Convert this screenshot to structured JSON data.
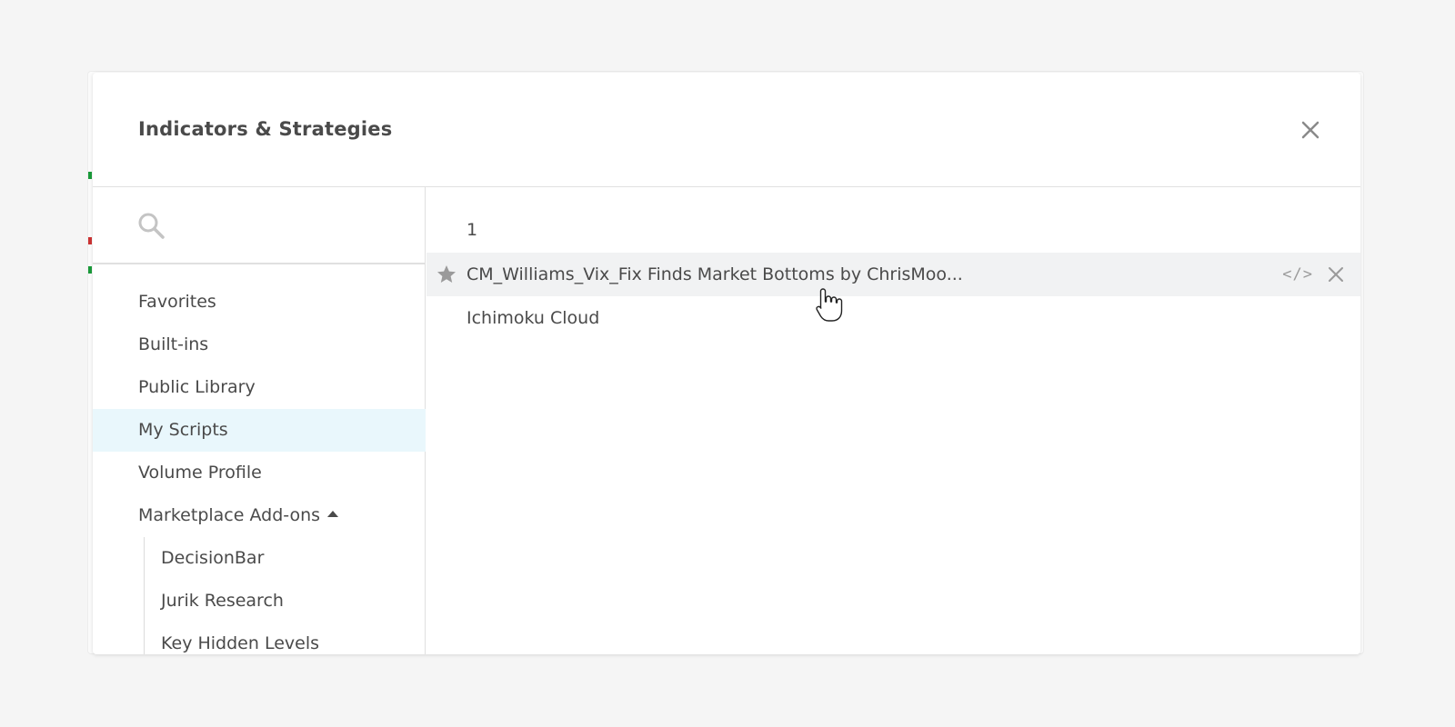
{
  "dialog": {
    "title": "Indicators & Strategies"
  },
  "search": {
    "value": "",
    "placeholder": ""
  },
  "sidebar": {
    "items": [
      {
        "label": "Favorites"
      },
      {
        "label": "Built-ins"
      },
      {
        "label": "Public Library"
      },
      {
        "label": "My Scripts",
        "active": true
      },
      {
        "label": "Volume Profile"
      },
      {
        "label": "Marketplace Add-ons"
      }
    ],
    "subitems": [
      {
        "label": "DecisionBar"
      },
      {
        "label": "Jurik Research"
      },
      {
        "label": "Key Hidden Levels"
      }
    ]
  },
  "content": {
    "group_header": "1",
    "scripts": [
      {
        "label": "CM_Williams_Vix_Fix Finds Market Bottoms by ChrisMoo...",
        "starred": true,
        "code_label": "</>"
      },
      {
        "label": "Ichimoku Cloud"
      }
    ]
  },
  "icons": {
    "close": "close-icon",
    "search": "search-icon",
    "star": "star-icon",
    "remove": "close-icon",
    "caret": "caret-up-icon"
  },
  "colors": {
    "active_bg": "#e9f7fc",
    "hover_bg": "#f1f2f3",
    "text": "#4a4a4a",
    "icon": "#9a9a9a"
  }
}
